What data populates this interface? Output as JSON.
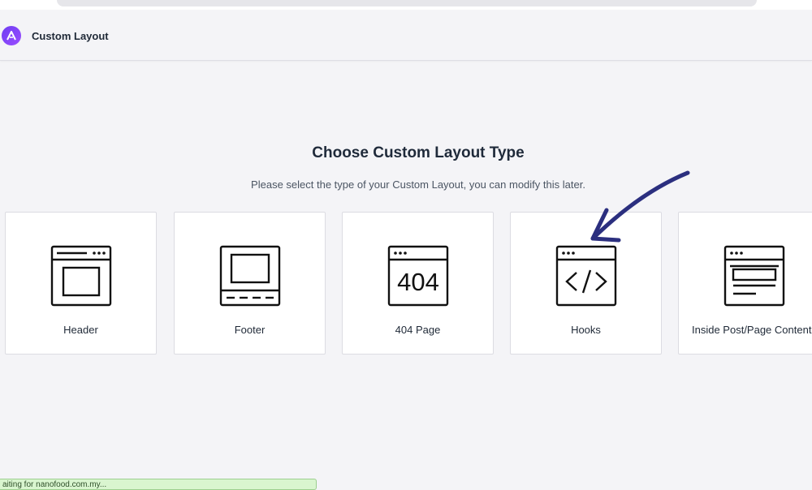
{
  "app": {
    "title": "Custom Layout",
    "logo_icon": "astra-logo-icon",
    "accent_color": "#7b46f6"
  },
  "main": {
    "heading": "Choose Custom Layout Type",
    "subheading": "Please select the type of your Custom Layout, you can modify this later."
  },
  "cards": [
    {
      "label": "Header",
      "icon": "header-layout-icon"
    },
    {
      "label": "Footer",
      "icon": "footer-layout-icon"
    },
    {
      "label": "404 Page",
      "icon": "404-page-icon",
      "icon_text": "404"
    },
    {
      "label": "Hooks",
      "icon": "code-hooks-icon"
    },
    {
      "label": "Inside Post/Page Content",
      "icon": "inside-content-icon"
    }
  ],
  "annotation": {
    "icon": "hand-drawn-arrow-icon",
    "color": "#2b2f7f"
  },
  "status_bar": {
    "text": "aiting for nanofood.com.my..."
  }
}
